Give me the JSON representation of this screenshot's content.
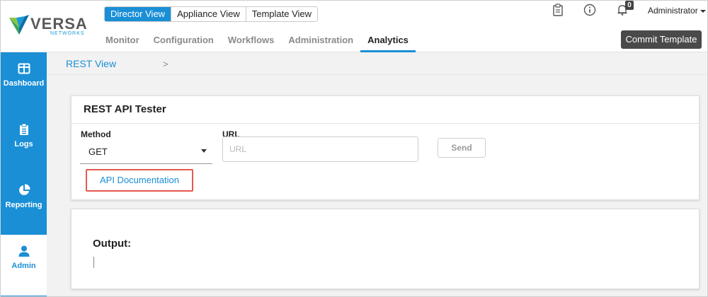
{
  "logo": {
    "word": "VERSA",
    "sub": "NETWORKS"
  },
  "views": [
    {
      "label": "Director View",
      "active": true
    },
    {
      "label": "Appliance View",
      "active": false
    },
    {
      "label": "Template View",
      "active": false
    }
  ],
  "nav": [
    {
      "label": "Monitor"
    },
    {
      "label": "Configuration"
    },
    {
      "label": "Workflows"
    },
    {
      "label": "Administration"
    },
    {
      "label": "Analytics"
    }
  ],
  "header": {
    "notification_count": "0",
    "user": "Administrator",
    "commit_label": "Commit Template"
  },
  "sidebar": {
    "items": [
      {
        "label": "Dashboard",
        "icon": "dashboard-icon"
      },
      {
        "label": "Logs",
        "icon": "clipboard-icon"
      },
      {
        "label": "Reporting",
        "icon": "pie-chart-icon"
      },
      {
        "label": "Admin",
        "icon": "user-icon"
      }
    ]
  },
  "breadcrumb": {
    "link": "REST View",
    "separator": ">"
  },
  "tester": {
    "title": "REST API Tester",
    "method_label": "Method",
    "method_value": "GET",
    "url_label": "URL",
    "url_placeholder": "URL",
    "send_label": "Send",
    "api_doc_label": "API Documentation"
  },
  "output": {
    "label": "Output:"
  },
  "colors": {
    "accent": "#1a8fd6",
    "highlight": "#e35a4f",
    "commit_bg": "#4a4a4a"
  }
}
